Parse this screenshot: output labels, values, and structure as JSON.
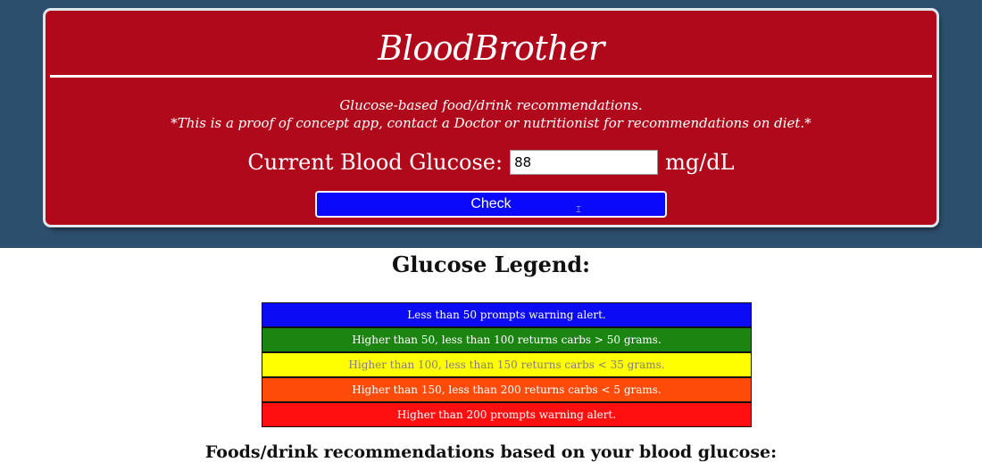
{
  "header": {
    "app_title": "BloodBrother",
    "tagline_line1": "Glucose-based food/drink recommendations.",
    "tagline_line2": "*This is a proof of concept app, contact a Doctor or nutritionist for recommendations on diet.*"
  },
  "glucose_form": {
    "label": "Current Blood Glucose:",
    "input_value": "88",
    "unit": "mg/dL",
    "check_label": "Check"
  },
  "legend": {
    "title": "Glucose Legend:",
    "rows": [
      {
        "text": "Less than 50 prompts warning alert.",
        "bg": "#0b0bf5",
        "fg": "#ffffff"
      },
      {
        "text": "Higher than 50, less than 100 returns carbs > 50 grams.",
        "bg": "#1c8411",
        "fg": "#ffffff"
      },
      {
        "text": "Higher than 100, less than 150 returns carbs < 35 grams.",
        "bg": "#ffff00",
        "fg": "#808080"
      },
      {
        "text": "Higher than 150, less than 200 returns carbs < 5 grams.",
        "bg": "#ff4b0a",
        "fg": "#ffffff"
      },
      {
        "text": "Higher than 200 prompts warning alert.",
        "bg": "#ff0f0f",
        "fg": "#ffffff"
      }
    ]
  },
  "recommendations": {
    "title": "Foods/drink recommendations based on your blood glucose:"
  },
  "colors": {
    "page_band": "#2d4f6e",
    "header_card": "#b0091c",
    "check_button": "#0a09fb"
  }
}
